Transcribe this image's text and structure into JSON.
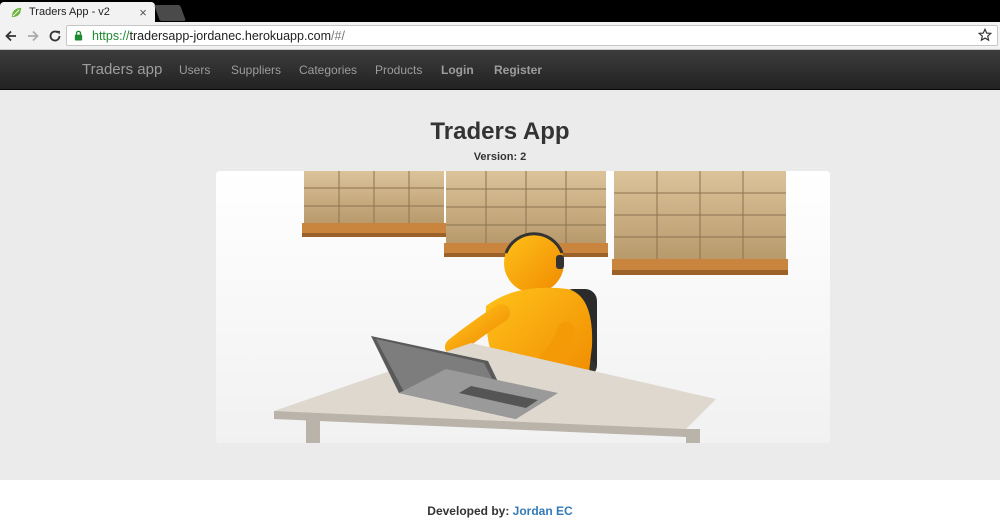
{
  "browser": {
    "tab_title": "Traders App - v2",
    "tab_close": "×",
    "url_scheme": "https://",
    "url_host": "tradersapp-jordanec.herokuapp.com",
    "url_path": "/#/",
    "secure_color": "#1e8a32"
  },
  "navbar": {
    "brand": "Traders app",
    "links": [
      "Users",
      "Suppliers",
      "Categories",
      "Products"
    ],
    "login": "Login",
    "register": "Register"
  },
  "main": {
    "title": "Traders App",
    "version_label": "Version: 2",
    "hero_image": "trader-at-laptop-with-warehouse-pallets"
  },
  "footer": {
    "developed_by": "Developed by:",
    "author": "Jordan EC",
    "author_color": "#337ab7"
  },
  "icons": {
    "favicon": "leaf-icon",
    "back": "arrow-left-icon",
    "forward": "arrow-right-icon",
    "reload": "reload-icon",
    "lock": "lock-icon",
    "bookmark": "star-icon"
  }
}
